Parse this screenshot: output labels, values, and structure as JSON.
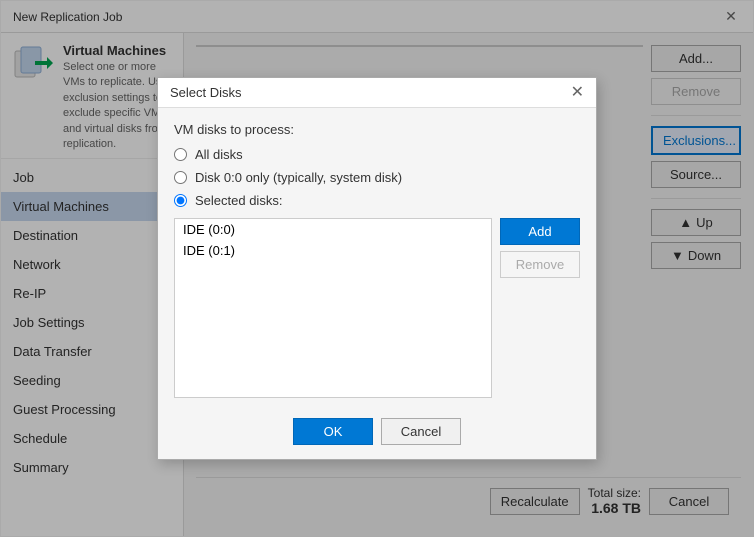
{
  "window": {
    "title": "New Replication Job"
  },
  "sidebar": {
    "header": {
      "title": "Virtual Machines",
      "description": "Select one or more VMs to replicate. Use exclusion settings to exclude specific VMs and virtual disks from replication."
    },
    "items": [
      {
        "id": "job",
        "label": "Job",
        "active": false
      },
      {
        "id": "virtual-machines",
        "label": "Virtual Machines",
        "active": true
      },
      {
        "id": "destination",
        "label": "Destination",
        "active": false
      },
      {
        "id": "network",
        "label": "Network",
        "active": false
      },
      {
        "id": "re-ip",
        "label": "Re-IP",
        "active": false
      },
      {
        "id": "job-settings",
        "label": "Job Settings",
        "active": false
      },
      {
        "id": "data-transfer",
        "label": "Data Transfer",
        "active": false
      },
      {
        "id": "seeding",
        "label": "Seeding",
        "active": false
      },
      {
        "id": "guest-processing",
        "label": "Guest Processing",
        "active": false
      },
      {
        "id": "schedule",
        "label": "Schedule",
        "active": false
      },
      {
        "id": "summary",
        "label": "Summary",
        "active": false
      }
    ]
  },
  "main": {
    "buttons": {
      "add": "Add...",
      "remove": "Remove",
      "exclusions": "Exclusions...",
      "source": "Source...",
      "up": "Up",
      "down": "Down",
      "recalculate": "Recalculate",
      "cancel": "Cancel"
    },
    "total_size_label": "Total size:",
    "total_size_value": "1.68 TB"
  },
  "modal": {
    "title": "Select Disks",
    "vm_disks_label": "VM disks to process:",
    "radio_options": [
      {
        "id": "all",
        "label": "All disks",
        "checked": false
      },
      {
        "id": "disk00",
        "label": "Disk 0:0 only (typically, system disk)",
        "checked": false
      },
      {
        "id": "selected",
        "label": "Selected disks:",
        "checked": true
      }
    ],
    "disk_list": [
      {
        "id": "ide00",
        "label": "IDE (0:0)"
      },
      {
        "id": "ide01",
        "label": "IDE (0:1)"
      }
    ],
    "buttons": {
      "add": "Add",
      "remove": "Remove",
      "ok": "OK",
      "cancel": "Cancel"
    }
  }
}
